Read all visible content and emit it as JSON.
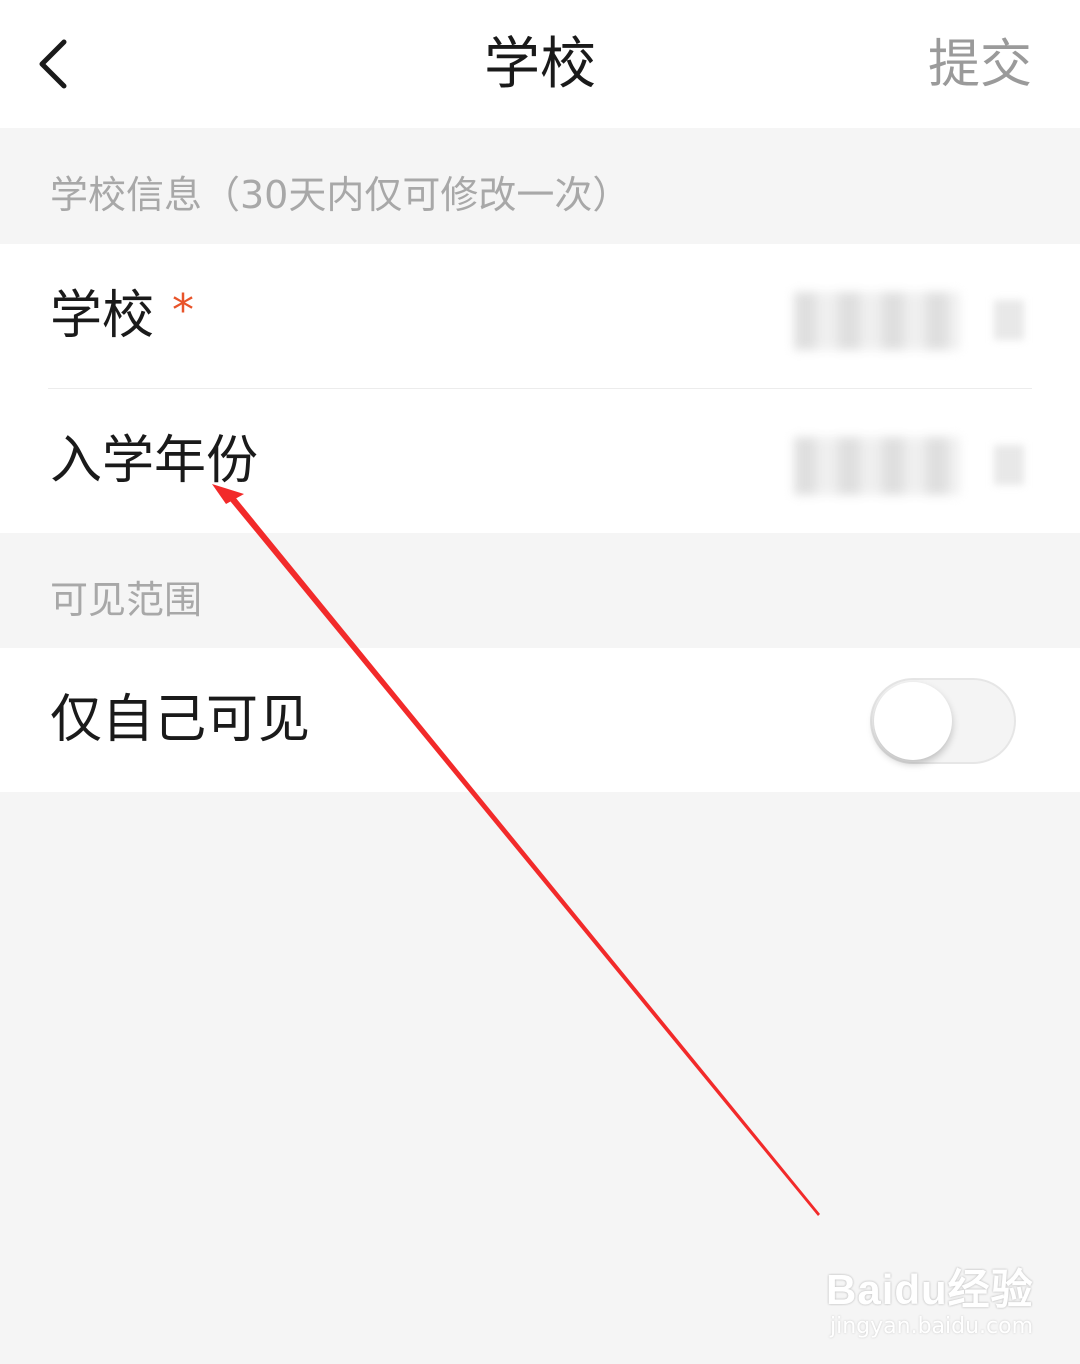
{
  "nav": {
    "back_label": "<",
    "title": "学校",
    "submit_label": "提交"
  },
  "sections": {
    "school_info_header": "学校信息（30天内仅可修改一次）",
    "visibility_header": "可见范围"
  },
  "rows": {
    "school_label": "学校",
    "required_mark": "*",
    "enroll_year_label": "入学年份",
    "self_only_label": "仅自己可见"
  },
  "toggle": {
    "self_only_on": false
  },
  "colors": {
    "accent_required": "#e8542a",
    "annotation_arrow": "#f22a2a"
  },
  "watermark": {
    "logo_text": "Baidu经验",
    "url": "jingyan.baidu.com"
  }
}
